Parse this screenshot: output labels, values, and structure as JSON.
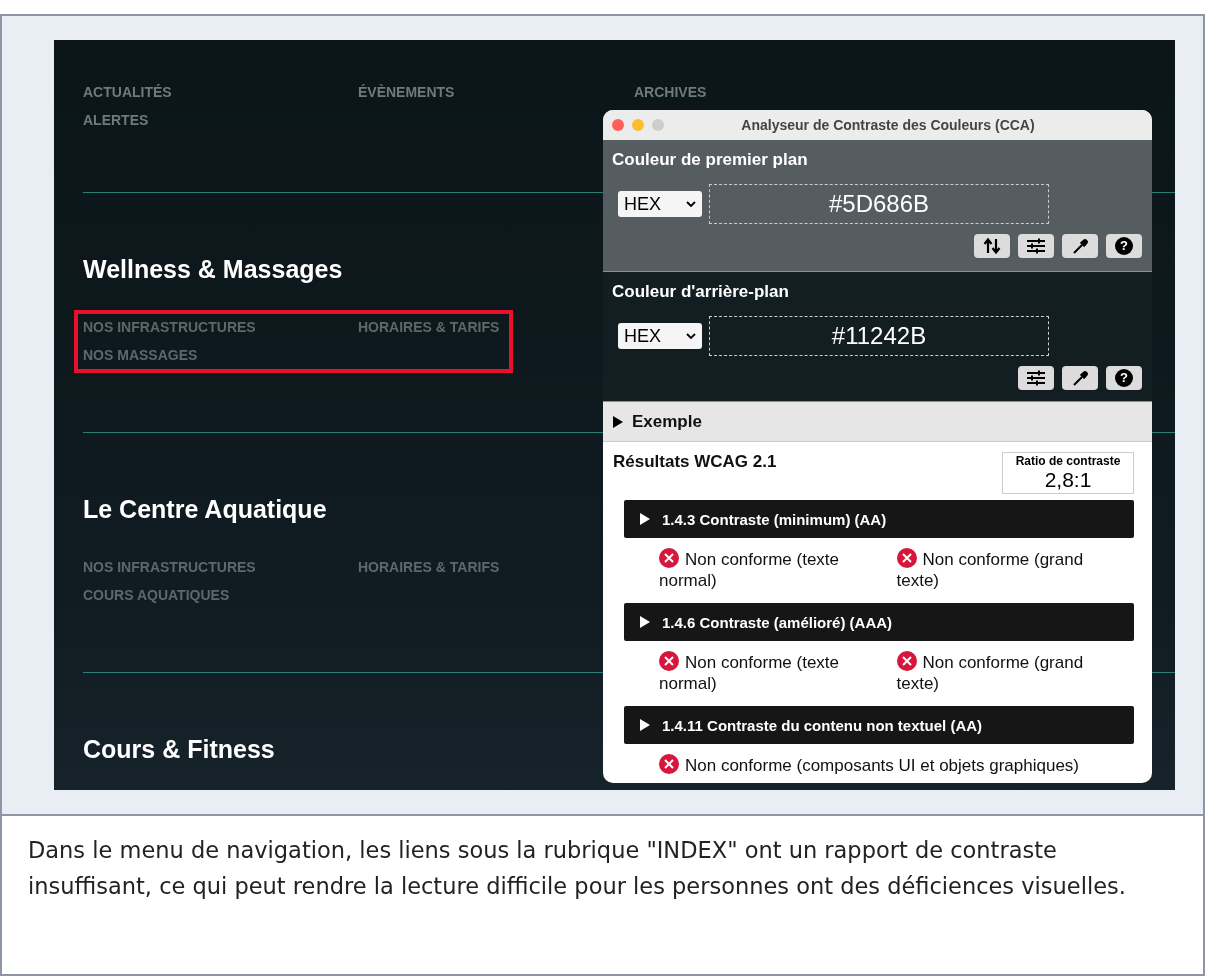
{
  "screenshot": {
    "top_nav": [
      "ACTUALITÉS",
      "ÉVÈNEMENTS",
      "ARCHIVES",
      "ALERTES"
    ],
    "sections": [
      {
        "title": "Wellness & Massages",
        "highlighted": true,
        "links": [
          "NOS INFRASTRUCTURES",
          "HORAIRES & TARIFS",
          "NOS MASSAGES"
        ]
      },
      {
        "title": "Le Centre Aquatique",
        "highlighted": false,
        "links": [
          "NOS INFRASTRUCTURES",
          "HORAIRES & TARIFS",
          "COURS AQUATIQUES"
        ]
      },
      {
        "title": "Cours & Fitness"
      }
    ]
  },
  "cca_window": {
    "title": "Analyseur de Contraste des Couleurs (CCA)",
    "colors": [
      {
        "kind": "foreground",
        "heading": "Couleur de premier plan",
        "format": "HEX",
        "value": "#5D686B",
        "tools": [
          {
            "kind": "swap"
          },
          {
            "kind": "sliders"
          },
          {
            "kind": "eyedropper"
          },
          {
            "kind": "help",
            "label": "?"
          }
        ]
      },
      {
        "kind": "background",
        "heading": "Couleur d'arrière-plan",
        "format": "HEX",
        "value": "#11242B",
        "tools": [
          {
            "kind": "sliders"
          },
          {
            "kind": "eyedropper"
          },
          {
            "kind": "help",
            "label": "?"
          }
        ]
      }
    ],
    "example": {
      "label": "Exemple",
      "expanded": false
    },
    "results": {
      "title": "Résultats WCAG 2.1",
      "ratio_label": "Ratio de contraste",
      "ratio": "2,8:1",
      "criteria": [
        {
          "title": "1.4.3 Contraste (minimum) (AA)",
          "expanded": false,
          "outcomes": [
            {
              "text": "Non conforme (texte normal)",
              "pass": false
            },
            {
              "text": "Non conforme (grand texte)",
              "pass": false
            }
          ]
        },
        {
          "title": "1.4.6 Contraste (amélioré) (AAA)",
          "expanded": false,
          "outcomes": [
            {
              "text": "Non conforme (texte normal)",
              "pass": false
            },
            {
              "text": "Non conforme (grand texte)",
              "pass": false
            }
          ]
        },
        {
          "title": "1.4.11 Contraste du contenu non textuel (AA)",
          "expanded": false,
          "outcomes": [
            {
              "text": "Non conforme (composants UI et objets graphiques)",
              "pass": false
            }
          ]
        }
      ]
    }
  },
  "caption": "Dans le menu de navigation, les liens sous la rubrique \"INDEX\" ont un rapport de contraste insuffisant, ce qui peut rendre la lecture difficile pour les personnes ont des déficiences visuelles."
}
